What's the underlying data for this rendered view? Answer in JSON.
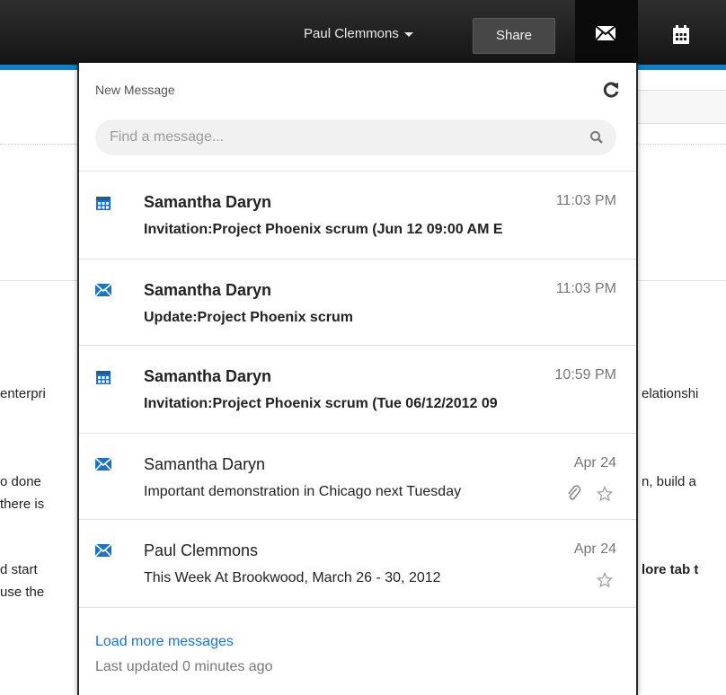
{
  "topbar": {
    "user_name": "Paul Clemmons",
    "share_label": "Share",
    "mail_icon": "envelope-icon",
    "calendar_icon": "calendar-icon"
  },
  "background": {
    "fragments": [
      "enterpri",
      "elationshi",
      "o done",
      "n, build a",
      "there is",
      "d start",
      "lore tab t",
      "use the"
    ]
  },
  "panel": {
    "header": "New Message",
    "refresh_icon": "refresh-icon",
    "search_placeholder": "Find a message...",
    "messages": [
      {
        "type": "calendar",
        "sender": "Samantha Daryn",
        "time": "11:03 PM",
        "subject": "Invitation:Project Phoenix scrum (Jun 12 09:00 AM E",
        "unread": true,
        "attachment": false,
        "star": false
      },
      {
        "type": "mail",
        "sender": "Samantha Daryn",
        "time": "11:03 PM",
        "subject": "Update:Project Phoenix scrum",
        "unread": true,
        "attachment": false,
        "star": false
      },
      {
        "type": "calendar",
        "sender": "Samantha Daryn",
        "time": "10:59 PM",
        "subject": "Invitation:Project Phoenix scrum (Tue 06/12/2012 09",
        "unread": true,
        "attachment": false,
        "star": false
      },
      {
        "type": "mail",
        "sender": "Samantha Daryn",
        "time": "Apr 24",
        "subject": "Important demonstration in Chicago next Tuesday",
        "unread": false,
        "attachment": true,
        "star": true
      },
      {
        "type": "mail",
        "sender": "Paul Clemmons",
        "time": "Apr 24",
        "subject": "This Week At Brookwood, March 26 - 30, 2012",
        "unread": false,
        "attachment": false,
        "star": true
      }
    ],
    "load_more": "Load more messages",
    "last_updated": "Last updated 0 minutes ago"
  },
  "colors": {
    "accent_blue": "#0f7fc6",
    "link_blue": "#1b74c4",
    "topbar_dark": "#1d1d1d"
  }
}
